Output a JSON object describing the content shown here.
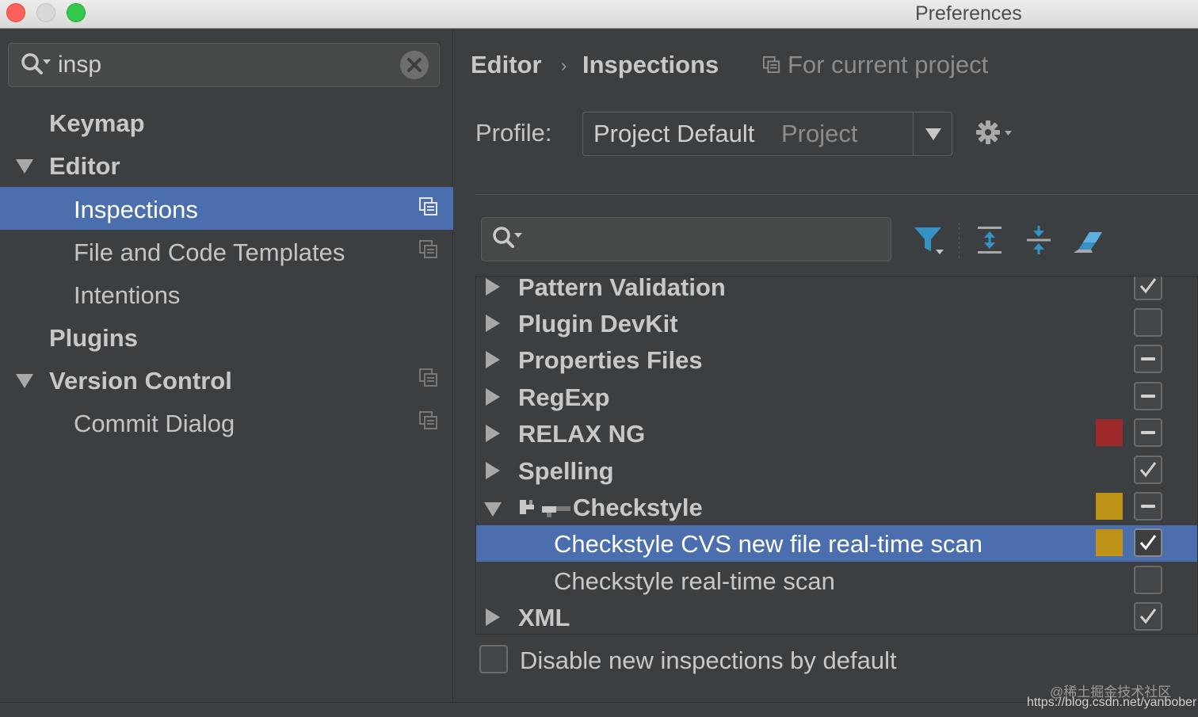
{
  "window": {
    "title": "Preferences"
  },
  "sidebar": {
    "search_value": "insp",
    "items": [
      {
        "label": "Keymap"
      },
      {
        "label": "Editor"
      },
      {
        "label": "Inspections"
      },
      {
        "label": "File and Code Templates"
      },
      {
        "label": "Intentions"
      },
      {
        "label": "Plugins"
      },
      {
        "label": "Version Control"
      },
      {
        "label": "Commit Dialog"
      }
    ]
  },
  "main": {
    "breadcrumb": [
      "Editor",
      "Inspections"
    ],
    "breadcrumb_separator": "›",
    "scope_note": "For current project",
    "profile_label": "Profile:",
    "profile_value": "Project Default",
    "profile_scope": "Project",
    "inspections": [
      {
        "label": "Pattern Validation",
        "state": "checked",
        "severity_color": null
      },
      {
        "label": "Plugin DevKit",
        "state": "unchecked",
        "severity_color": null
      },
      {
        "label": "Properties Files",
        "state": "mixed",
        "severity_color": null
      },
      {
        "label": "RegExp",
        "state": "mixed",
        "severity_color": null
      },
      {
        "label": "RELAX NG",
        "state": "mixed",
        "severity_color": "#9e2a2b"
      },
      {
        "label": "Spelling",
        "state": "checked",
        "severity_color": null
      },
      {
        "label": "Checkstyle",
        "state": "mixed",
        "severity_color": "#be9117"
      },
      {
        "label": "Checkstyle CVS new file real-time scan",
        "state": "checked",
        "severity_color": "#be9117",
        "selected": true
      },
      {
        "label": "Checkstyle real-time scan",
        "state": "unchecked",
        "severity_color": null
      },
      {
        "label": "XML",
        "state": "checked",
        "severity_color": null
      }
    ],
    "disable_new_label": "Disable new inspections by default"
  },
  "watermark": {
    "line1": "@稀土掘金技术社区",
    "line2": "https://blog.csdn.net/yanbober"
  },
  "colors": {
    "selection": "#4b6eaf",
    "background": "#3c3f41",
    "filter_icon": "#3592c4"
  }
}
